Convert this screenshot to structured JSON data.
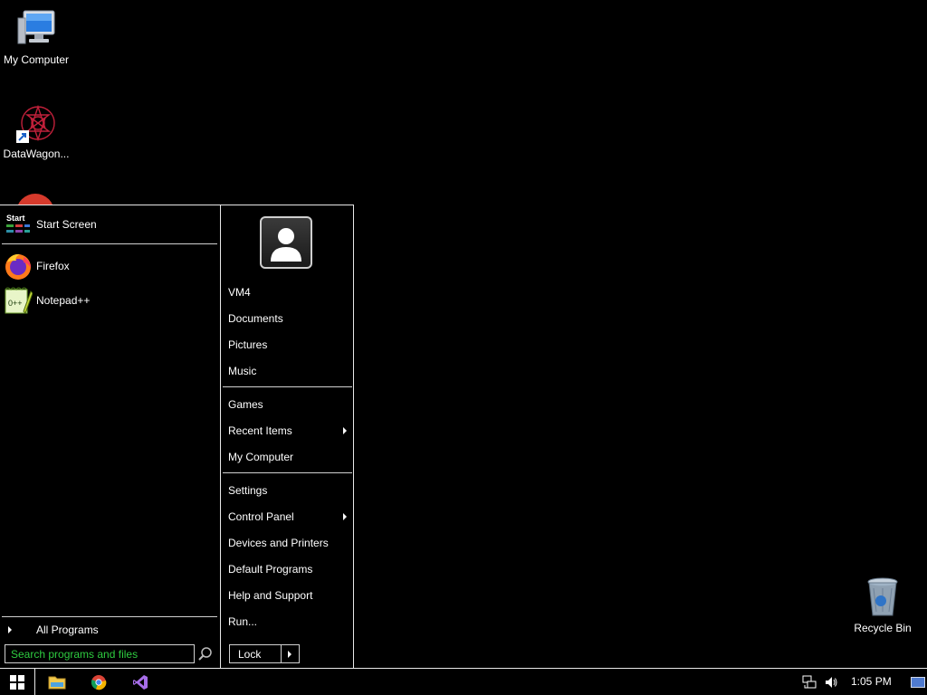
{
  "desktop": {
    "icons": [
      {
        "label": "My Computer",
        "icon": "my-computer-icon"
      },
      {
        "label": "DataWagon...",
        "icon": "datawagon-shortcut-icon"
      },
      {
        "label": "Recycle Bin",
        "icon": "recycle-bin-icon"
      }
    ]
  },
  "start_menu": {
    "start_screen": {
      "label": "Start Screen",
      "tag": "Start"
    },
    "pinned": [
      {
        "label": "Firefox",
        "icon": "firefox-icon"
      },
      {
        "label": "Notepad++",
        "icon": "notepad-plus-plus-icon"
      }
    ],
    "all_programs": "All Programs",
    "search": {
      "placeholder": "Search programs and files",
      "value": ""
    },
    "places_group1": [
      "VM4",
      "Documents",
      "Pictures",
      "Music"
    ],
    "places_group2": [
      "Games",
      "Recent Items",
      "My Computer"
    ],
    "places_group3": [
      "Settings",
      "Control Panel",
      "Devices and Printers",
      "Default Programs",
      "Help and Support",
      "Run..."
    ],
    "lock_label": "Lock"
  },
  "taskbar": {
    "pinned": [
      "file-explorer-icon",
      "chrome-icon",
      "visual-studio-icon"
    ],
    "clock": "1:05 PM",
    "tray": [
      "network-icon",
      "volume-icon",
      "show-desktop-icon"
    ]
  },
  "colors": {
    "accent_search_text": "#2ecc40",
    "border": "#e8e8e8",
    "background": "#000000"
  }
}
